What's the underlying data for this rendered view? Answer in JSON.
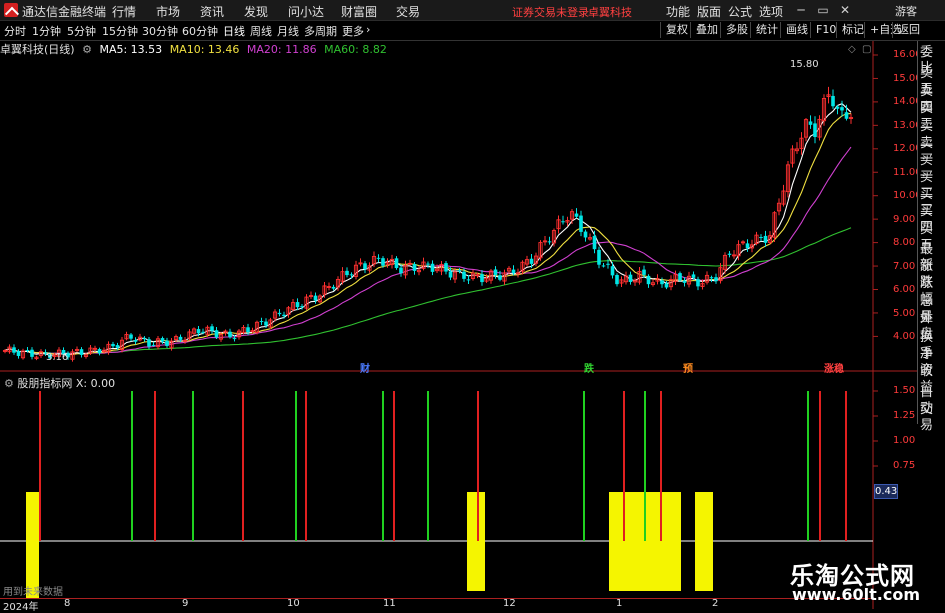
{
  "window": {
    "app_title": "通达信金融终端",
    "menu": [
      "行情",
      "市场",
      "资讯",
      "发现",
      "问小达",
      "财富圈",
      "交易"
    ],
    "notice": "证券交易未登录",
    "stock_name_header": "卓翼科技",
    "right_menu": [
      "功能",
      "版面",
      "公式",
      "选项"
    ],
    "user": "游客",
    "min_icon": "minimize-icon",
    "max_icon": "maximize-icon",
    "close_icon": "close-icon"
  },
  "toolbar": {
    "periods": [
      "分时",
      "1分钟",
      "5分钟",
      "15分钟",
      "30分钟",
      "60分钟",
      "日线",
      "周线",
      "月线",
      "多周期",
      "更多"
    ],
    "active_period": "日线",
    "right_buttons": [
      "复权",
      "叠加",
      "多股",
      "统计",
      "画线",
      "F10",
      "标记",
      "+自选",
      "返回"
    ]
  },
  "main_chart": {
    "title": "卓翼科技(日线)",
    "ma5": "MA5: 13.53",
    "ma10": "MA10: 13.46",
    "ma20": "MA20: 11.86",
    "ma60": "MA60: 8.82",
    "high_label": "15.80",
    "low_label": "3.16",
    "colors": {
      "ma5": "#ffffff",
      "ma10": "#f0e040",
      "ma20": "#d040d0",
      "ma60": "#30c030",
      "up": "#ff3030",
      "down": "#00e5e5"
    },
    "markers": [
      {
        "text": "财",
        "color": "#4a7bff"
      },
      {
        "text": "跌",
        "color": "#30d030"
      },
      {
        "text": "预",
        "color": "#ff8c20"
      },
      {
        "text": "涨稳",
        "color": "#ff4040"
      }
    ],
    "axis": [
      "16.00",
      "15.00",
      "14.00",
      "13.00",
      "12.00",
      "11.00",
      "10.00",
      "9.00",
      "8.00",
      "7.00",
      "6.00",
      "5.00",
      "4.00"
    ]
  },
  "right_panel": {
    "items": [
      "委比",
      "卖五",
      "卖四",
      "卖三",
      "卖二",
      "卖一",
      "买一",
      "买二",
      "买三",
      "买四",
      "买五",
      "最新",
      "涨跌",
      "涨幅",
      "总量",
      "外盘",
      "换手",
      "净资",
      "收益",
      "自动",
      "交易"
    ]
  },
  "indicator": {
    "title": "股朋指标网 X: 0.00",
    "axis": [
      "1.50",
      "1.25",
      "1.00",
      "0.75"
    ],
    "current_value": "0.43"
  },
  "dates": [
    "2024年",
    "8",
    "9",
    "10",
    "11",
    "12",
    "1",
    "2"
  ],
  "footer_text": "用到未来数据",
  "watermark": {
    "line1": "乐淘公式网",
    "line2": "www.60lt.com"
  }
}
